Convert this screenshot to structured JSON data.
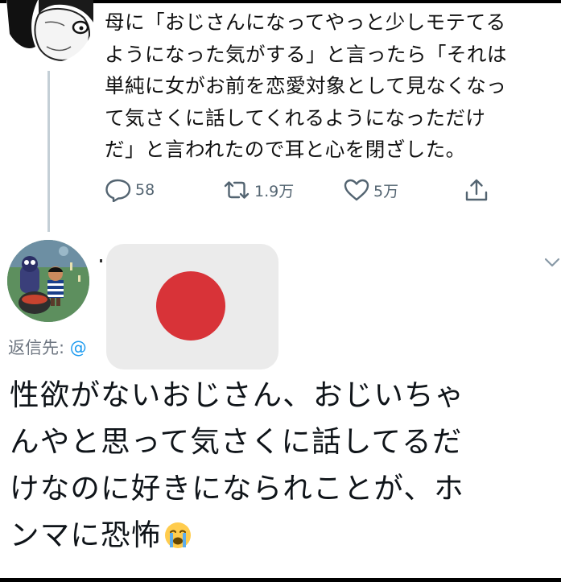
{
  "tweet1": {
    "text_lines": [
      "母に「おじさんになってやっと少しモテてる",
      "ようになった気がする」と言ったら「それは",
      "単純に女がお前を恋愛対象として見なくなっ",
      "て気さくに話してくれるようになっただけ",
      "だ」と言われたので耳と心を閉ざした。"
    ],
    "reply_count": "58",
    "retweet_count": "1.9万",
    "like_count": "5万"
  },
  "tweet2": {
    "reply_to_label": "返信先:",
    "reply_to_handle": "@",
    "text_lines": [
      "性欲がないおじさん、おじいちゃ",
      "んやと思って気さくに話してるだ",
      "けなのに好きになられことが、ホ",
      "ンマに恐怖"
    ],
    "emoji": "loudly-crying-face"
  },
  "icons": [
    "reply-icon",
    "retweet-icon",
    "like-icon",
    "share-icon",
    "chevron-down-icon"
  ],
  "colors": {
    "icon_gray": "#536471",
    "link_blue": "#1d9bf0",
    "redaction_red": "#d83338"
  }
}
